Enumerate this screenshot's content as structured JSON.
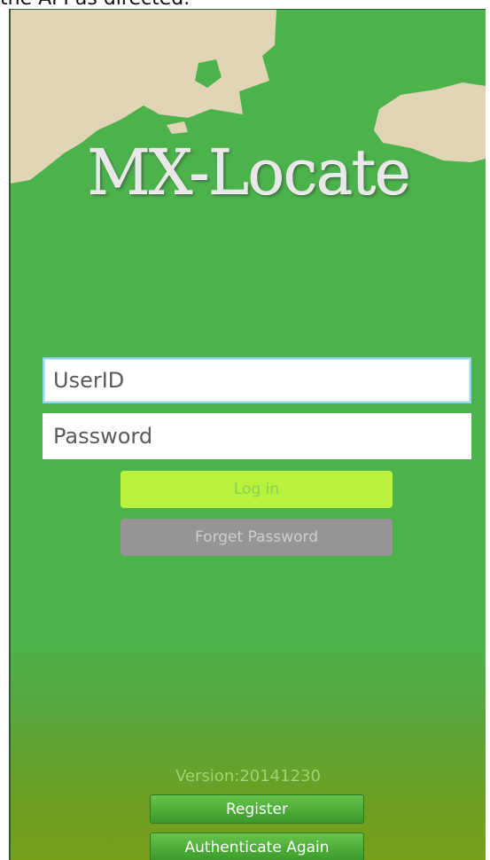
{
  "caption": "the API as directed.",
  "app": {
    "title": "MX-Locate"
  },
  "login_form": {
    "userid_placeholder": "UserID",
    "password_placeholder": "Password",
    "login_label": "Log in",
    "forget_label": "Forget Password"
  },
  "footer": {
    "version_text": "Version:20141230",
    "register_label": "Register",
    "authenticate_label": "Authenticate Again"
  },
  "colors": {
    "background_green": "#4cb34c",
    "map_land": "#e2d5b6",
    "login_button": "#b9f23c",
    "forget_button": "#959595",
    "footer_button": "#4aa83a"
  }
}
